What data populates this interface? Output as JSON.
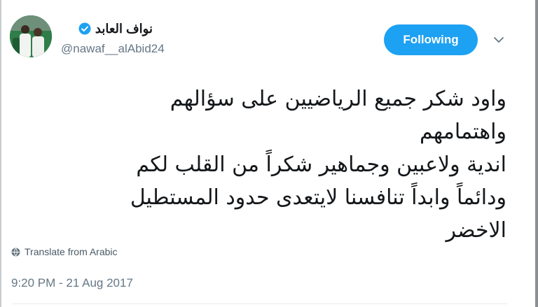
{
  "header": {
    "display_name": "نواف العابد",
    "username": "@nawaf__alAbid24",
    "verified": true,
    "follow_button_label": "Following",
    "avatar_icon": "profile-photo",
    "caret_icon": "chevron-down-icon"
  },
  "tweet": {
    "lines": [
      "واود شكر جميع الرياضيين على سؤالهم",
      "واهتمامهم",
      "اندية ولاعبين وجماهير شكراً من القلب لكم",
      "ودائماً وابداً تنافسنا لايتعدى حدود المستطيل",
      "الاخضر"
    ]
  },
  "translate_label": "Translate from Arabic",
  "timestamp": "9:20 PM - 21 Aug 2017",
  "colors": {
    "accent": "#1da1f2",
    "secondary_text": "#657786",
    "primary_text": "#14171a"
  }
}
